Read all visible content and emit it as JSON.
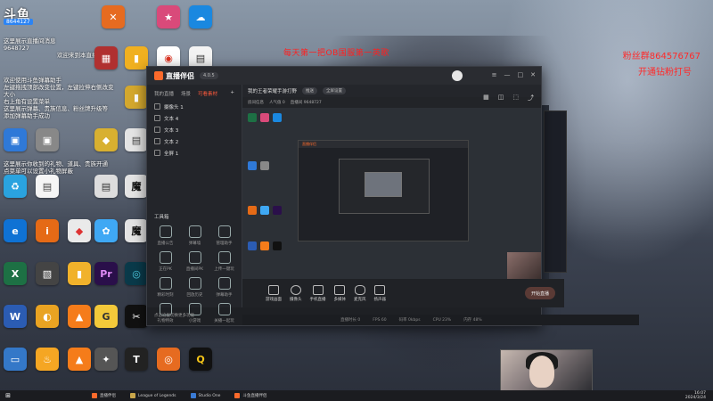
{
  "overlay": {
    "site_logo": "斗鱼",
    "site_id": "8644127",
    "banner_center": "每天第一把OB国服第一英歌",
    "right_line1": "粉丝群864576767",
    "right_line2": "开通钻粉打号",
    "chat_top": [
      "这里展示直播间消息",
      "9648727",
      "欢迎来到本直播间"
    ],
    "chat_mid": [
      "欢迎使用斗鱼弹幕助手",
      "左键拖拽顶部改变位置，左键拉伸右侧改变",
      "大小",
      "右上角有设置菜单",
      "这里展示弹幕、贵族信息、粉丝牌升级等",
      "添加弹幕助手成功"
    ],
    "chat_bottom": [
      "这里展示你收到的礼物、道具、贵族开通",
      "点菜单可以设置小礼物屏蔽"
    ]
  },
  "desktop_icons": [
    {
      "label": "",
      "color": "#e66b20",
      "glyph": "✕"
    },
    {
      "label": "",
      "color": "#d94a7a",
      "glyph": "★"
    },
    {
      "label": "",
      "color": "#1a88e0",
      "glyph": "☁"
    },
    {
      "label": "",
      "color": "#3ba55d",
      "glyph": "W"
    },
    {
      "label": "",
      "color": "#e8e8e8",
      "glyph": "G"
    },
    {
      "label": "",
      "color": "#f0b020",
      "glyph": "▮"
    }
  ],
  "app": {
    "logo": "直播伴侣",
    "version": "4.0.5",
    "tabs": [
      "我的直播",
      "场景",
      "可看素材"
    ],
    "active_tab": 2,
    "sources": [
      "摄像头 1",
      "文本 4",
      "文本 3",
      "文本 2",
      "全屏 1"
    ],
    "tools_title": "工具箱",
    "tools": [
      "直播公告",
      "弹幕墙",
      "管理助手",
      "正在PK",
      "直播间PK",
      "上传一键玩",
      "精彩时刻",
      "回放历史",
      "弹幕助手",
      "礼物特效",
      "小游戏",
      "关播一起玩"
    ],
    "hint": "点击这里切换更多功能",
    "scene_title": "我的王者荣耀手游打野",
    "scene_pill1": "推送",
    "scene_pill2": "全屏设置",
    "sub_labels": [
      "房间信息",
      "人气值 0",
      "直播间 9648727"
    ],
    "bottom_bar": [
      "游戏画面",
      "摄像头",
      "手机直播",
      "多媒体",
      "麦克风",
      "扬声器"
    ],
    "start_button": "开始直播",
    "status": [
      "直播时长 0",
      "FPS 60",
      "码率 0kbps",
      "CPU 23%",
      "内存 48%"
    ]
  },
  "taskbar": {
    "start": "⊞",
    "items": [
      "直播伴侣",
      "League of Legends",
      "Studio One",
      "斗鱼直播伴侣"
    ],
    "clock_time": "16:07",
    "clock_date": "2024/3/24"
  }
}
